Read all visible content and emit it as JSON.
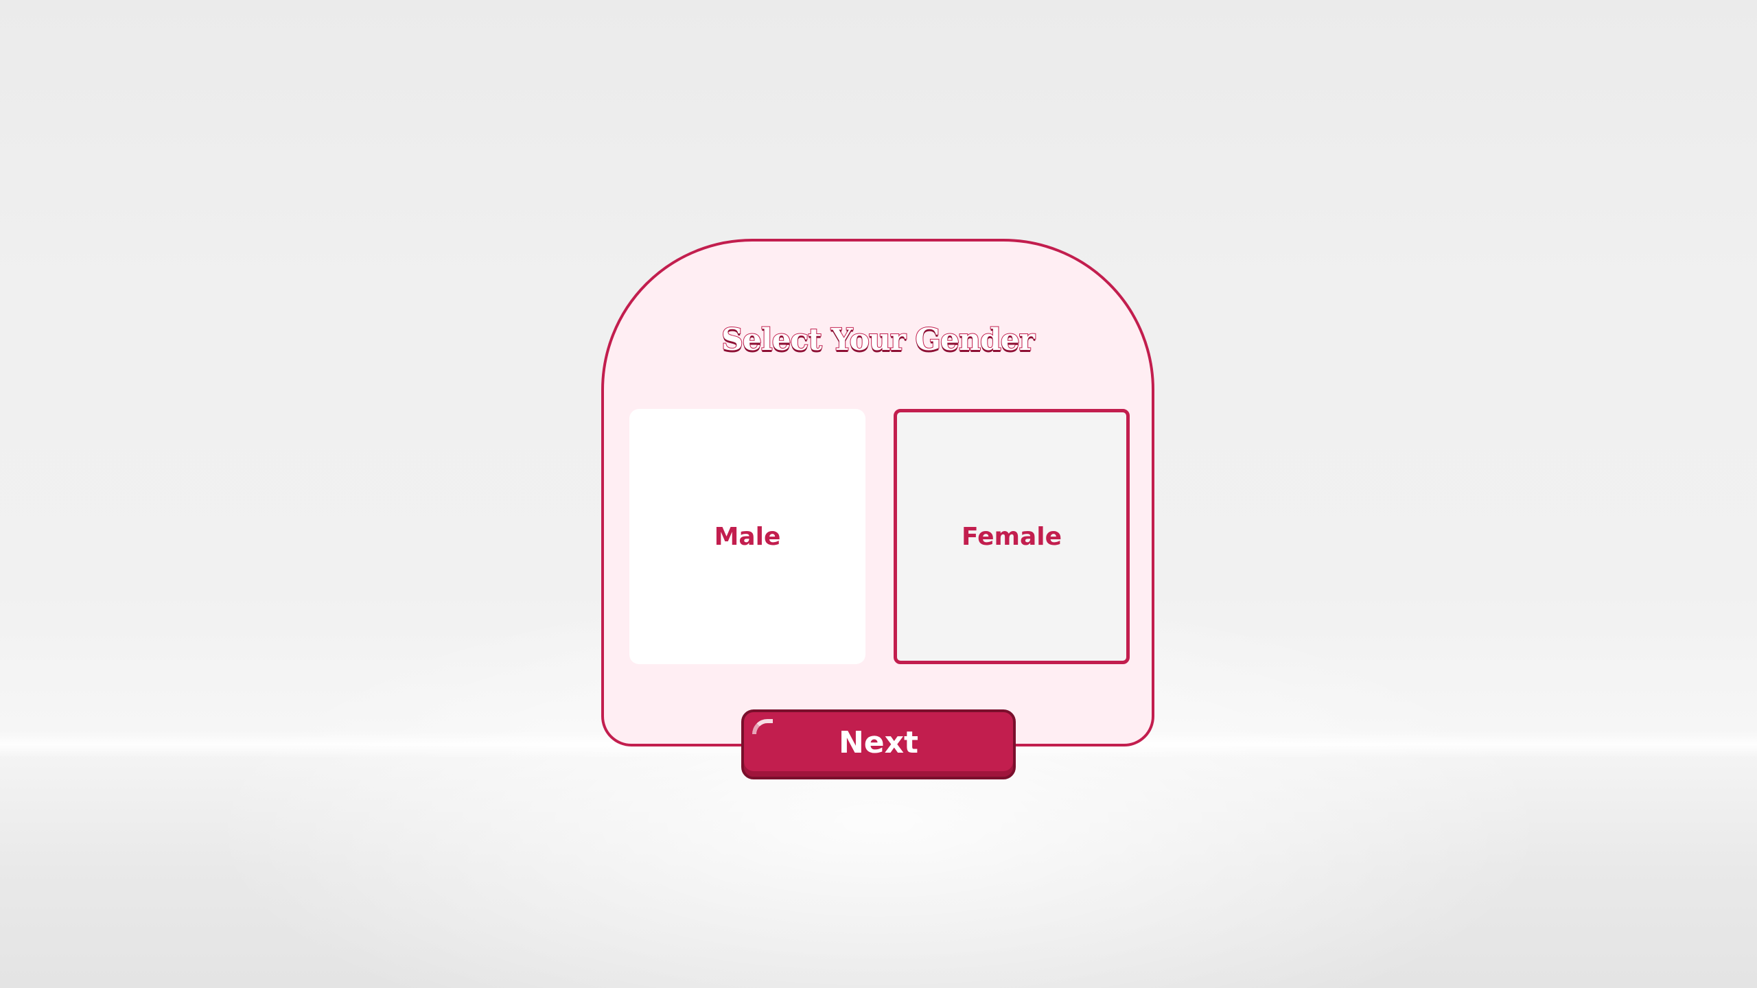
{
  "dialog": {
    "title": "Select Your Gender",
    "options": [
      {
        "label": "Male",
        "selected": false
      },
      {
        "label": "Female",
        "selected": true
      }
    ],
    "next_label": "Next"
  },
  "colors": {
    "accent": "#c21e4e",
    "panel_background": "#ffeef3",
    "option_background": "#ffffff",
    "selected_option_background": "#f4f4f4"
  }
}
